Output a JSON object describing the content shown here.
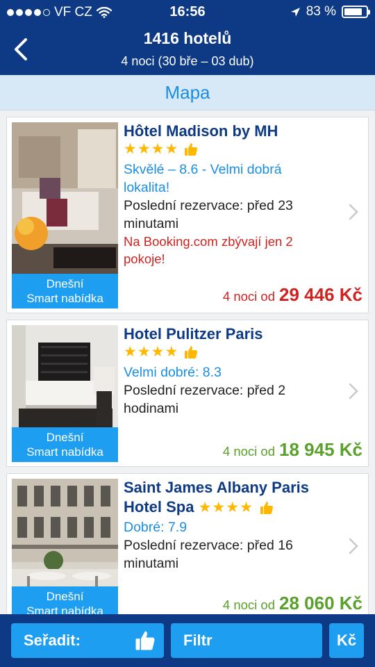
{
  "status_bar": {
    "carrier": "VF CZ",
    "time": "16:56",
    "battery": "83 %",
    "battery_level": 0.83,
    "signal_dots_filled": 4
  },
  "header": {
    "title": "1416 hotelů",
    "subtitle": "4 noci (30 bře – 03 dub)"
  },
  "map_link": "Mapa",
  "hotels": [
    {
      "name": "Hôtel Madison by MH",
      "stars": 4,
      "rating_text_line1": "Skvělé – 8.6 - Velmi dobrá",
      "rating_text_line2": "lokalita!",
      "last_booking_line1": "Poslední rezervace: před 23",
      "last_booking_line2": "minutami",
      "scarcity_line1": "Na Booking.com zbývají jen 2",
      "scarcity_line2": "pokoje!",
      "badge_line1": "Dnešní",
      "badge_line2": "Smart nabídka",
      "price_prefix": "4 noci od",
      "price": "29 446 Kč",
      "price_color": "#d0231f"
    },
    {
      "name": "Hotel Pulitzer Paris",
      "stars": 4,
      "rating_text": "Velmi dobré: 8.3",
      "last_booking_line1": "Poslední rezervace: před 2",
      "last_booking_line2": "hodinami",
      "badge_line1": "Dnešní",
      "badge_line2": "Smart nabídka",
      "price_prefix": "4 noci od",
      "price": "18 945 Kč",
      "price_color": "#59a12b"
    },
    {
      "name_line1": "Saint James Albany Paris",
      "name_line2": "Hotel Spa",
      "stars": 4,
      "rating_text": "Dobré: 7.9",
      "last_booking_line1": "Poslední rezervace: před 16",
      "last_booking_line2": "minutami",
      "badge_line1": "Dnešní",
      "badge_line2": "Smart nabídka",
      "price_prefix": "4 noci od",
      "price": "28 060 Kč",
      "price_color": "#59a12b"
    }
  ],
  "bottom_bar": {
    "sort_label": "Seřadit:",
    "filter_label": "Filtr",
    "currency_label": "Kč"
  },
  "colors": {
    "brand_dark_blue": "#0e3a85",
    "accent_blue": "#1e9ef0",
    "link_blue": "#1a8ee0",
    "star_yellow": "#ffb700",
    "price_red": "#d0231f",
    "price_green": "#59a12b"
  },
  "icons": [
    "wifi-icon",
    "location-arrow-icon",
    "battery-icon",
    "back-chevron-icon",
    "star-icon",
    "thumbs-up-icon",
    "chevron-right-icon"
  ]
}
